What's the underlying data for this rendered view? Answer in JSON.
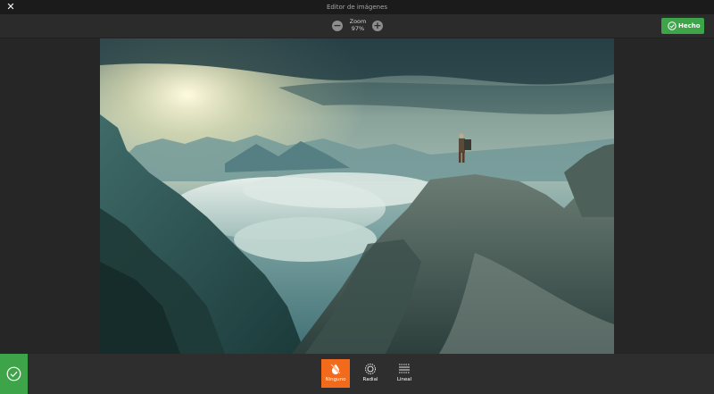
{
  "window": {
    "title": "Editor de imágenes"
  },
  "toolbar": {
    "zoom_label": "Zoom",
    "zoom_value": "97%",
    "done_label": "Hecho"
  },
  "bottom_tools": [
    {
      "label": "Ninguno",
      "icon": "no-gradient-icon",
      "active": true
    },
    {
      "label": "Radial",
      "icon": "radial-gradient-icon",
      "active": false
    },
    {
      "label": "Lineal",
      "icon": "linear-gradient-icon",
      "active": false
    }
  ],
  "colors": {
    "accent_green": "#3ea449",
    "active_orange": "#f26a1c",
    "background": "#262626"
  }
}
